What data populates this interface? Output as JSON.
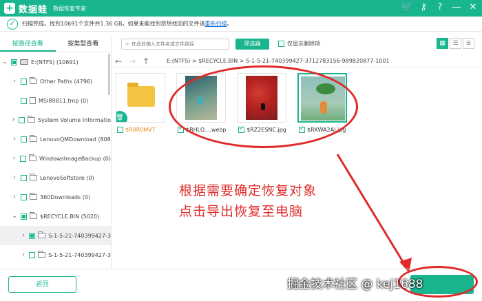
{
  "app": {
    "name": "数据蛙",
    "subtitle": "数据恢复专家"
  },
  "titlebar_icons": [
    "cart-icon",
    "key-icon",
    "help-icon",
    "minimize-icon",
    "close-icon"
  ],
  "status": {
    "message": "扫描完成。找到10691个文件共1.36 GB。如果未能找到您想找回的文件请",
    "link": "重新扫描",
    "suffix": "。"
  },
  "tabs": [
    {
      "label": "按路径查看",
      "active": true
    },
    {
      "label": "按类型查看",
      "active": false
    }
  ],
  "tree": [
    {
      "label": "E:(NTFS) (10691)",
      "arrow": "v",
      "icon": "drive",
      "check": "partial"
    },
    {
      "label": "Other Paths (4796)",
      "arrow": ">",
      "icon": "folder",
      "check": "empty"
    },
    {
      "label": "MSI89811.tmp (0)",
      "arrow": "",
      "icon": "file",
      "check": "empty"
    },
    {
      "label": "System Volume Informatio",
      "arrow": ">",
      "icon": "folder",
      "check": "empty"
    },
    {
      "label": "LenovoQMDownload (808",
      "arrow": ">",
      "icon": "folder",
      "check": "empty"
    },
    {
      "label": "WindowsImageBackup (0)",
      "arrow": ">",
      "icon": "folder",
      "check": "empty"
    },
    {
      "label": "LenovoSoftstore (0)",
      "arrow": ">",
      "icon": "folder",
      "check": "empty"
    },
    {
      "label": "360Downloads (0)",
      "arrow": ">",
      "icon": "folder",
      "check": "empty"
    },
    {
      "label": "$RECYCLE.BIN (5020)",
      "arrow": "v",
      "icon": "folder",
      "check": "partial"
    },
    {
      "label": "S-1-5-21-740399427-3",
      "arrow": ">",
      "icon": "folder",
      "check": "partial",
      "selected": true
    },
    {
      "label": "S-1-5-21-740399427-3",
      "arrow": ">",
      "icon": "folder",
      "check": "empty"
    }
  ],
  "toolbar": {
    "search_placeholder": "在此处输入文件名或文件路径",
    "filter_label": "筛选器",
    "deleted_only_label": "仅显示删除项"
  },
  "path": "E:(NTFS) > $RECYCLE.BIN > S-1-5-21-740399427-3712783156-989820877-1001",
  "files": [
    {
      "name": "$R8R0MVT",
      "type": "folder",
      "checked": false,
      "color": "#e88a1a"
    },
    {
      "name": "$RHLO....webp",
      "type": "image",
      "checked": true
    },
    {
      "name": "$RZ2ESNC.jpg",
      "type": "image",
      "checked": true
    },
    {
      "name": "$RKWA2AI.jpg",
      "type": "image",
      "checked": true,
      "selected": true
    }
  ],
  "annotation": {
    "line1": "根据需要确定恢复对象",
    "line2": "点击导出恢复至电脑"
  },
  "buttons": {
    "back": "返回",
    "export": ""
  },
  "watermark": "掘金技术社区 @ kej1688",
  "colors": {
    "brand": "#18b58e",
    "annotation": "#e02a2a",
    "link": "#1a6fd6"
  }
}
